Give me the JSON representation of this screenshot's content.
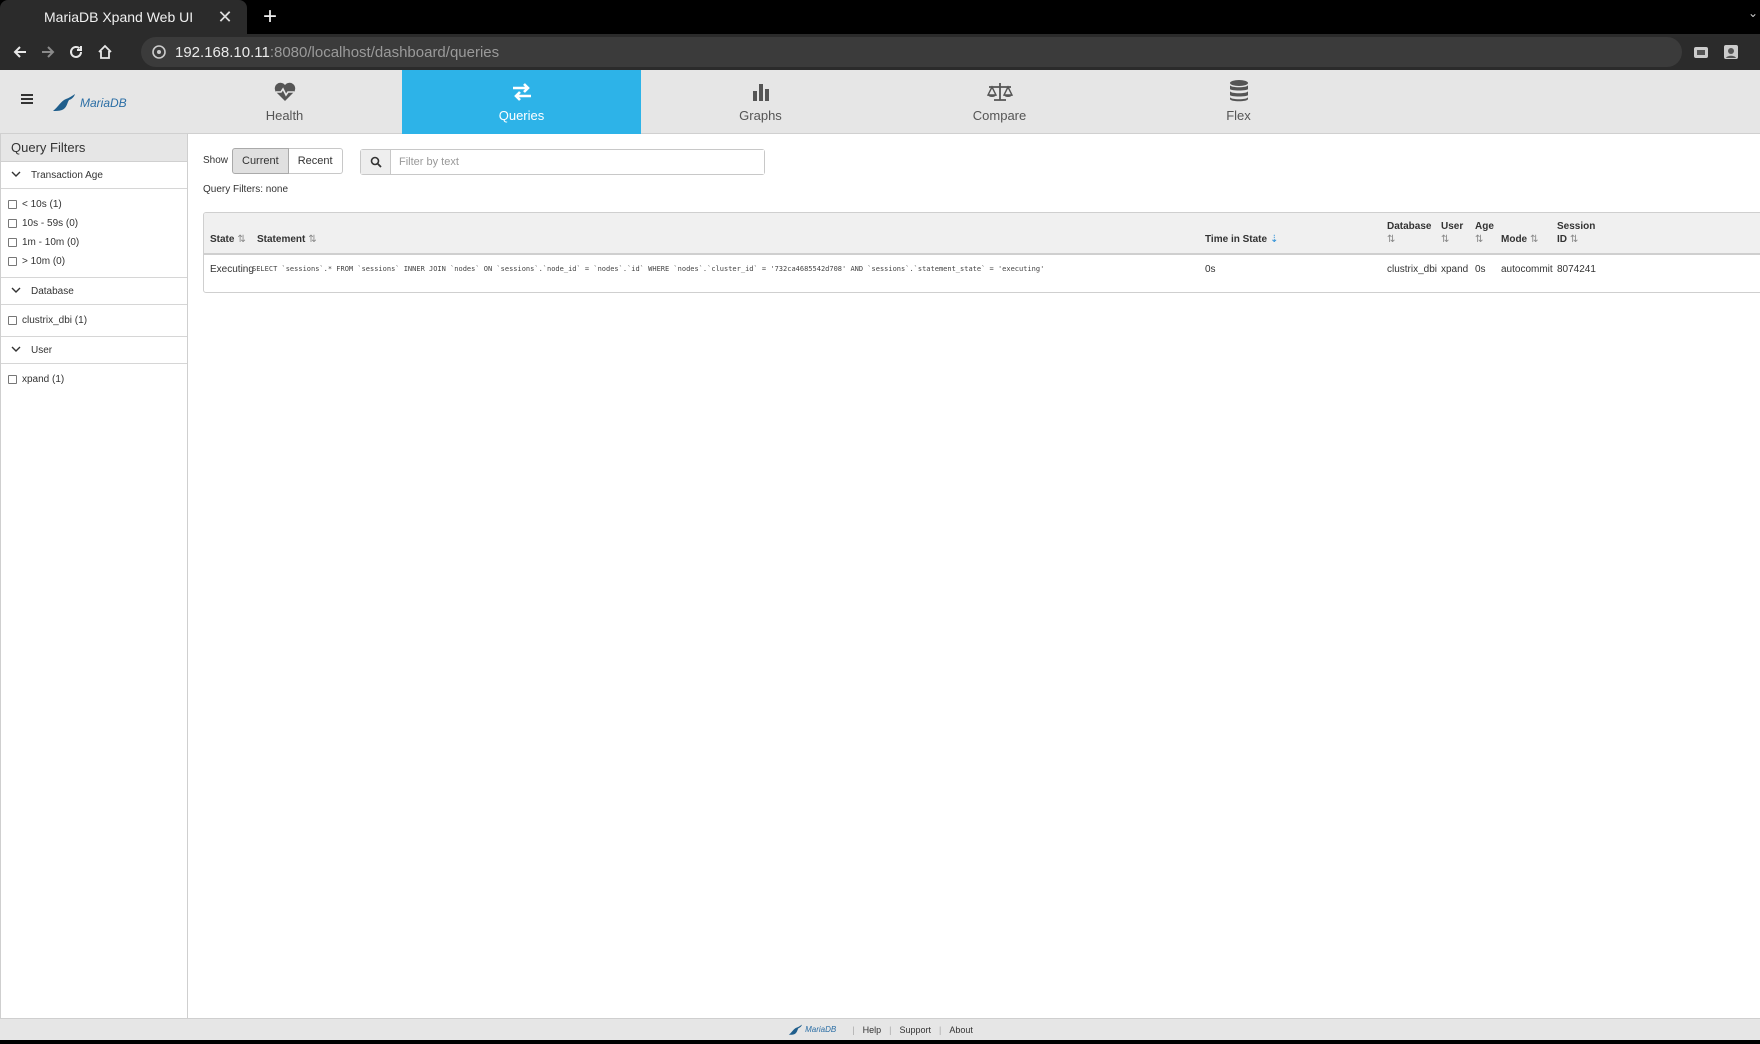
{
  "browser": {
    "tab_title": "MariaDB Xpand Web UI",
    "url_host": "192.168.10.11",
    "url_rest": ":8080/localhost/dashboard/queries"
  },
  "app": {
    "logo_text": "MariaDB",
    "nav": [
      {
        "label": "Health",
        "icon": "heart-pulse-icon",
        "active": false
      },
      {
        "label": "Queries",
        "icon": "arrows-exchange-icon",
        "active": true
      },
      {
        "label": "Graphs",
        "icon": "bar-chart-icon",
        "active": false
      },
      {
        "label": "Compare",
        "icon": "scale-icon",
        "active": false
      },
      {
        "label": "Flex",
        "icon": "database-icon",
        "active": false
      }
    ],
    "accent_color": "#2db3e8"
  },
  "sidebar": {
    "title": "Query Filters",
    "sections": [
      {
        "label": "Transaction Age",
        "items": [
          "< 10s (1)",
          "10s - 59s (0)",
          "1m - 10m (0)",
          "> 10m (0)"
        ]
      },
      {
        "label": "Database",
        "items": [
          "clustrix_dbi (1)"
        ]
      },
      {
        "label": "User",
        "items": [
          "xpand (1)"
        ]
      }
    ]
  },
  "main": {
    "show_label": "Show",
    "show_options": [
      "Current",
      "Recent"
    ],
    "show_selected": "Current",
    "search_placeholder": "Filter by text",
    "query_filters_text": "Query Filters: none",
    "columns": {
      "state": "State",
      "statement": "Statement",
      "time_in_state": "Time in State",
      "database_l1": "Database",
      "user": "User",
      "age": "Age",
      "mode": "Mode",
      "session_l1": "Session",
      "session_l2": "ID"
    },
    "rows": [
      {
        "state": "Executing",
        "statement": "SELECT `sessions`.* FROM `sessions` INNER JOIN `nodes` ON `sessions`.`node_id` = `nodes`.`id` WHERE `nodes`.`cluster_id` = '732ca4685542d708' AND `sessions`.`statement_state` = 'executing'",
        "time_in_state": "0s",
        "database": "clustrix_dbi",
        "user": "xpand",
        "age": "0s",
        "mode": "autocommit",
        "session_id": "8074241"
      }
    ]
  },
  "footer": {
    "logo_text": "MariaDB",
    "links": [
      "Help",
      "Support",
      "About"
    ]
  }
}
